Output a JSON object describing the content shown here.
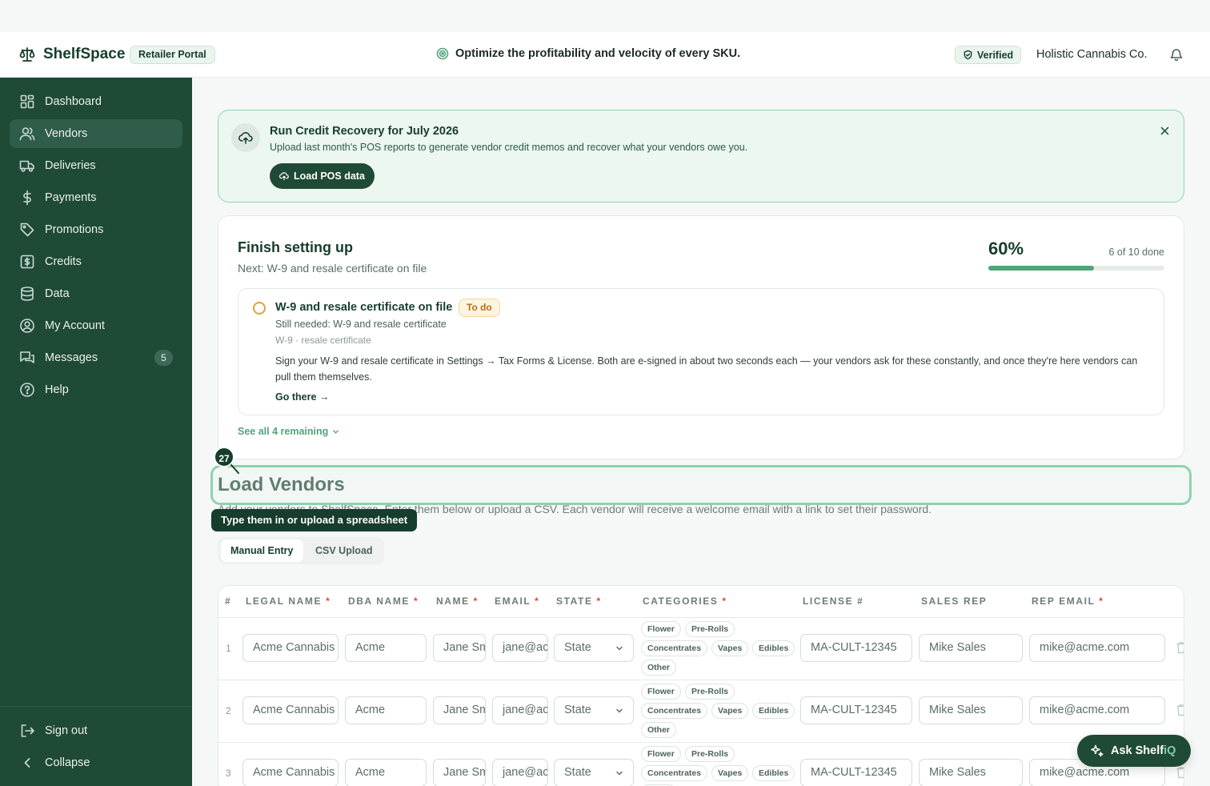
{
  "header": {
    "brand": "ShelfSpace",
    "portal_label": "Retailer Portal",
    "tagline": "Optimize the profitability and velocity of every SKU.",
    "verified_label": "Verified",
    "company": "Holistic Cannabis Co."
  },
  "sidebar": {
    "items": [
      {
        "label": "Dashboard",
        "icon": "dashboard-icon"
      },
      {
        "label": "Vendors",
        "icon": "users-icon",
        "active": true
      },
      {
        "label": "Deliveries",
        "icon": "truck-icon"
      },
      {
        "label": "Payments",
        "icon": "dollar-icon"
      },
      {
        "label": "Promotions",
        "icon": "tag-icon"
      },
      {
        "label": "Credits",
        "icon": "credit-icon"
      },
      {
        "label": "Data",
        "icon": "database-icon"
      },
      {
        "label": "My Account",
        "icon": "account-icon"
      },
      {
        "label": "Messages",
        "icon": "messages-icon",
        "badge": "5"
      },
      {
        "label": "Help",
        "icon": "help-icon"
      }
    ],
    "sign_out": "Sign out",
    "collapse": "Collapse"
  },
  "banner": {
    "title": "Run Credit Recovery for July 2026",
    "subtitle": "Upload last month's POS reports to generate vendor credit memos and recover what your vendors owe you.",
    "button": "Load POS data"
  },
  "setup": {
    "title": "Finish setting up",
    "next": "Next: W-9 and resale certificate on file",
    "percent_label": "60%",
    "progress": 0.6,
    "done_label": "6 of 10 done",
    "task": {
      "title": "W-9 and resale certificate on file",
      "status": "To do",
      "needed": "Still needed: W-9 and resale certificate",
      "tags": "W-9 · resale certificate",
      "description": "Sign your W-9 and resale certificate in Settings → Tax Forms & License. Both are e-signed in about two seconds each — your vendors ask for these constantly, and once they're here vendors can pull them themselves.",
      "link": "Go there →"
    },
    "see_all": "See all 4 remaining"
  },
  "load": {
    "title": "Load Vendors",
    "subtitle": "Add your vendors to ShelfSpace. Enter them below or upload a CSV. Each vendor will receive a welcome email with a link to set their password.",
    "tabs": [
      "Manual Entry",
      "CSV Upload"
    ],
    "step_number": "27",
    "tooltip": "Type them in or upload a spreadsheet"
  },
  "table": {
    "headers": [
      "#",
      "LEGAL NAME",
      "DBA NAME",
      "NAME",
      "EMAIL",
      "STATE",
      "CATEGORIES",
      "LICENSE #",
      "SALES REP",
      "REP EMAIL"
    ],
    "required": [
      "",
      "*",
      "*",
      "*",
      "*",
      "*",
      "*",
      "",
      "",
      "*"
    ],
    "categories": [
      "Flower",
      "Pre-Rolls",
      "Concentrates",
      "Vapes",
      "Edibles",
      "Other"
    ],
    "rows": [
      {
        "num": "1",
        "legal": "Acme Cannabis",
        "dba": "Acme",
        "name": "Jane Smith",
        "email": "jane@acme.com",
        "state": "State",
        "license": "MA-CULT-12345",
        "rep": "Mike Sales",
        "rep_email": "mike@acme.com"
      },
      {
        "num": "2",
        "legal": "Acme Cannabis",
        "dba": "Acme",
        "name": "Jane Smith",
        "email": "jane@acme.com",
        "state": "State",
        "license": "MA-CULT-12345",
        "rep": "Mike Sales",
        "rep_email": "mike@acme.com"
      },
      {
        "num": "3",
        "legal": "Acme Cannabis",
        "dba": "Acme",
        "name": "Jane Smith",
        "email": "jane@acme.com",
        "state": "State",
        "license": "MA-CULT-12345",
        "rep": "Mike Sales",
        "rep_email": "mike@acme.com"
      }
    ]
  },
  "assistant": {
    "label_prefix": "Ask Shelf",
    "label_suffix": "iQ"
  },
  "colors": {
    "sidebar": "#1f4a36",
    "accent": "#4fa57a",
    "highlight": "#8fd3ad",
    "warning": "#e2a23a",
    "required": "#d9453a"
  }
}
